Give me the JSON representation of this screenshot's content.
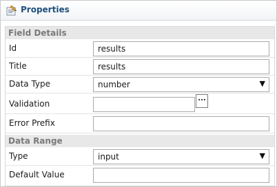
{
  "titlebar": {
    "title": "Properties",
    "icon": "properties-icon"
  },
  "sections": {
    "field_details": "Field Details",
    "data_range": "Data Range"
  },
  "rows": {
    "id": {
      "label": "Id",
      "value": "results"
    },
    "title": {
      "label": "Title",
      "value": "results"
    },
    "data_type": {
      "label": "Data Type",
      "value": "number"
    },
    "validation": {
      "label": "Validation",
      "value": "",
      "button": "..."
    },
    "error_prefix": {
      "label": "Error Prefix",
      "value": ""
    },
    "type": {
      "label": "Type",
      "value": "input"
    },
    "default_value": {
      "label": "Default Value",
      "value": ""
    }
  },
  "dropdown_arrow": "▼"
}
